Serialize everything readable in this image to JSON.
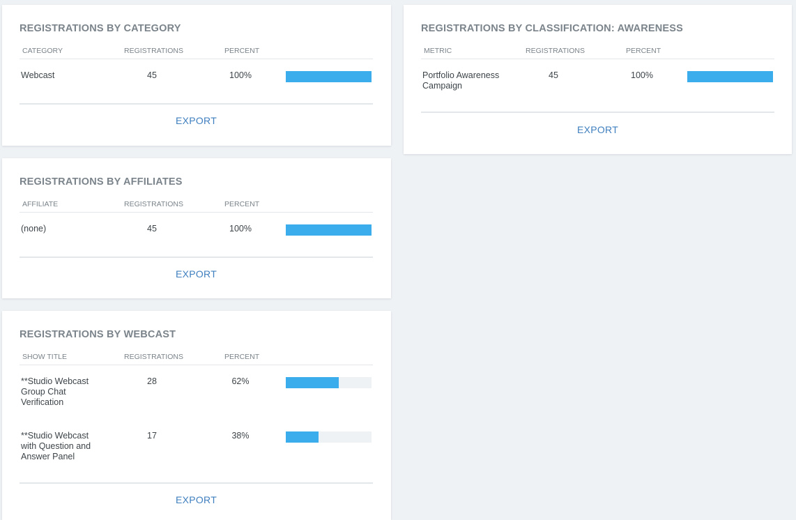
{
  "category_card": {
    "title": "REGISTRATIONS BY CATEGORY",
    "headers": [
      "CATEGORY",
      "REGISTRATIONS",
      "PERCENT"
    ],
    "rows": [
      {
        "name": "Webcast",
        "registrations": "45",
        "percent": "100%",
        "fraction": 1.0
      }
    ],
    "export_label": "EXPORT"
  },
  "affiliates_card": {
    "title": "REGISTRATIONS BY AFFILIATES",
    "headers": [
      "AFFILIATE",
      "REGISTRATIONS",
      "PERCENT"
    ],
    "rows": [
      {
        "name": "(none)",
        "registrations": "45",
        "percent": "100%",
        "fraction": 1.0
      }
    ],
    "export_label": "EXPORT"
  },
  "webcast_card": {
    "title": "REGISTRATIONS BY WEBCAST",
    "headers": [
      "SHOW TITLE",
      "REGISTRATIONS",
      "PERCENT"
    ],
    "rows": [
      {
        "name": "**Studio Webcast Group Chat Verification",
        "registrations": "28",
        "percent": "62%",
        "fraction": 0.62
      },
      {
        "name": "**Studio Webcast with Question and Answer Panel",
        "registrations": "17",
        "percent": "38%",
        "fraction": 0.38
      }
    ],
    "export_label": "EXPORT"
  },
  "classification_card": {
    "title": "REGISTRATIONS BY CLASSIFICATION: AWARENESS",
    "headers": [
      "METRIC",
      "REGISTRATIONS",
      "PERCENT"
    ],
    "rows": [
      {
        "name": "Portfolio Awareness Campaign",
        "registrations": "45",
        "percent": "100%",
        "fraction": 1.0
      }
    ],
    "export_label": "EXPORT"
  },
  "colors": {
    "bar_fill": "#3badec",
    "bar_track": "#eef2f5",
    "export_link": "#3f7fbf",
    "title": "#7b848b"
  }
}
